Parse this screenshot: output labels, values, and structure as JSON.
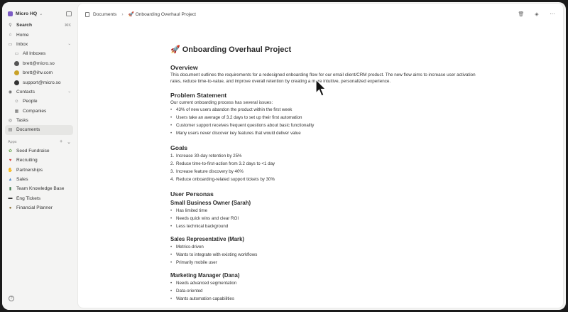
{
  "sidebar": {
    "workspace": "Micro HQ",
    "search": {
      "label": "Search",
      "shortcut": "⌘K"
    },
    "home": "Home",
    "inbox": "Inbox",
    "inbox_items": [
      "All Inboxes",
      "brett@micro.so",
      "brett@ihv.com",
      "support@micro.so"
    ],
    "contacts": "Contacts",
    "contact_items": [
      "People",
      "Companies"
    ],
    "tasks": "Tasks",
    "documents": "Documents",
    "apps_label": "Apps",
    "apps": [
      {
        "label": "Seed Fundraise",
        "icon": "seedling-icon",
        "color": "#6aa84f"
      },
      {
        "label": "Recruiting",
        "icon": "heart-icon",
        "color": "#d43f3a"
      },
      {
        "label": "Partnerships",
        "icon": "handshake-icon",
        "color": "#e0a030"
      },
      {
        "label": "Sales",
        "icon": "chart-icon",
        "color": "#4a86c5"
      },
      {
        "label": "Team Knowledge Base",
        "icon": "book-icon",
        "color": "#3d7a4a"
      },
      {
        "label": "Eng Tickets",
        "icon": "computer-icon",
        "color": "#333333"
      },
      {
        "label": "Financial Planner",
        "icon": "money-bag-icon",
        "color": "#8a6d2e"
      }
    ]
  },
  "topbar": {
    "breadcrumb_root": "Documents",
    "breadcrumb_current": "🚀 Onboarding Overhaul Project"
  },
  "doc": {
    "title": "🚀 Onboarding Overhaul Project",
    "overview_heading": "Overview",
    "overview_text": "This document outlines the requirements for a redesigned onboarding flow for our email client/CRM product. The new flow aims to increase user activation rates, reduce time-to-value, and improve overall retention by creating a more intuitive, personalized experience.",
    "problem_heading": "Problem Statement",
    "problem_intro": "Our current onboarding process has several issues:",
    "problems": [
      "43% of new users abandon the product within the first week",
      "Users take an average of 3.2 days to set up their first automation",
      "Customer support receives frequent questions about basic functionality",
      "Many users never discover key features that would deliver value"
    ],
    "goals_heading": "Goals",
    "goals": [
      "Increase 30-day retention by 25%",
      "Reduce time-to-first-action from 3.2 days to <1 day",
      "Increase feature discovery by 40%",
      "Reduce onboarding-related support tickets by 30%"
    ],
    "personas_heading": "User Personas",
    "persona1": {
      "name": "Small Business Owner (Sarah)",
      "traits": [
        "Has limited time",
        "Needs quick wins and clear ROI",
        "Less technical background"
      ]
    },
    "persona2": {
      "name": "Sales Representative (Mark)",
      "traits": [
        "Metrics-driven",
        "Wants to integrate with existing workflows",
        "Primarily mobile user"
      ]
    },
    "persona3": {
      "name": "Marketing Manager (Dana)",
      "traits": [
        "Needs advanced segmentation",
        "Data-oriented",
        "Wants automation capabilities"
      ]
    }
  },
  "colors": {
    "accent": "#7c5cc4",
    "active_bg": "#e6e6e4",
    "panel_bg": "#ffffff",
    "sidebar_bg": "#f4f4f3"
  }
}
